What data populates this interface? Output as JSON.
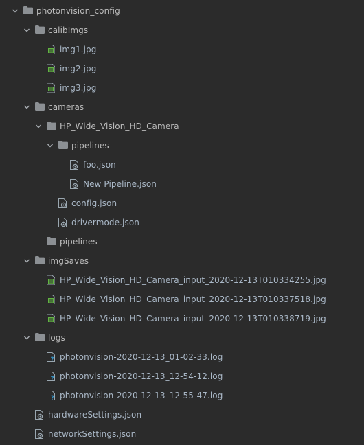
{
  "colors": {
    "background": "#2b2b2b",
    "folder": "#8c9094",
    "image_file": "#62b543",
    "json_file": "#9aa7b0",
    "unknown_file": "#3592c4",
    "text": "#bbbbbb"
  },
  "tree": [
    {
      "label": "photonvision_config",
      "type": "folder",
      "expanded": true,
      "depth": 0,
      "icon": "folder-icon"
    },
    {
      "label": "calibImgs",
      "type": "folder",
      "expanded": true,
      "depth": 1,
      "icon": "folder-icon"
    },
    {
      "label": "img1.jpg",
      "type": "image",
      "depth": 2,
      "icon": "image-file-icon"
    },
    {
      "label": "img2.jpg",
      "type": "image",
      "depth": 2,
      "icon": "image-file-icon"
    },
    {
      "label": "img3.jpg",
      "type": "image",
      "depth": 2,
      "icon": "image-file-icon"
    },
    {
      "label": "cameras",
      "type": "folder",
      "expanded": true,
      "depth": 1,
      "icon": "folder-icon"
    },
    {
      "label": "HP_Wide_Vision_HD_Camera",
      "type": "folder",
      "expanded": true,
      "depth": 2,
      "icon": "folder-icon"
    },
    {
      "label": "pipelines",
      "type": "folder",
      "expanded": true,
      "depth": 3,
      "icon": "folder-icon"
    },
    {
      "label": "foo.json",
      "type": "json",
      "depth": 4,
      "icon": "json-file-icon"
    },
    {
      "label": "New Pipeline.json",
      "type": "json",
      "depth": 4,
      "icon": "json-file-icon"
    },
    {
      "label": "config.json",
      "type": "json",
      "depth": 3,
      "icon": "json-file-icon"
    },
    {
      "label": "drivermode.json",
      "type": "json",
      "depth": 3,
      "icon": "json-file-icon"
    },
    {
      "label": "pipelines",
      "type": "folder",
      "expanded": false,
      "depth": 2,
      "icon": "folder-icon",
      "no_chevron": true
    },
    {
      "label": "imgSaves",
      "type": "folder",
      "expanded": true,
      "depth": 1,
      "icon": "folder-icon"
    },
    {
      "label": "HP_Wide_Vision_HD_Camera_input_2020-12-13T010334255.jpg",
      "type": "image",
      "depth": 2,
      "icon": "image-file-icon"
    },
    {
      "label": "HP_Wide_Vision_HD_Camera_input_2020-12-13T010337518.jpg",
      "type": "image",
      "depth": 2,
      "icon": "image-file-icon"
    },
    {
      "label": "HP_Wide_Vision_HD_Camera_input_2020-12-13T010338719.jpg",
      "type": "image",
      "depth": 2,
      "icon": "image-file-icon"
    },
    {
      "label": "logs",
      "type": "folder",
      "expanded": true,
      "depth": 1,
      "icon": "folder-icon"
    },
    {
      "label": "photonvision-2020-12-13_01-02-33.log",
      "type": "unknown",
      "depth": 2,
      "icon": "unknown-file-icon"
    },
    {
      "label": "photonvision-2020-12-13_12-54-12.log",
      "type": "unknown",
      "depth": 2,
      "icon": "unknown-file-icon"
    },
    {
      "label": "photonvision-2020-12-13_12-55-47.log",
      "type": "unknown",
      "depth": 2,
      "icon": "unknown-file-icon"
    },
    {
      "label": "hardwareSettings.json",
      "type": "json",
      "depth": 1,
      "icon": "json-file-icon"
    },
    {
      "label": "networkSettings.json",
      "type": "json",
      "depth": 1,
      "icon": "json-file-icon"
    }
  ]
}
